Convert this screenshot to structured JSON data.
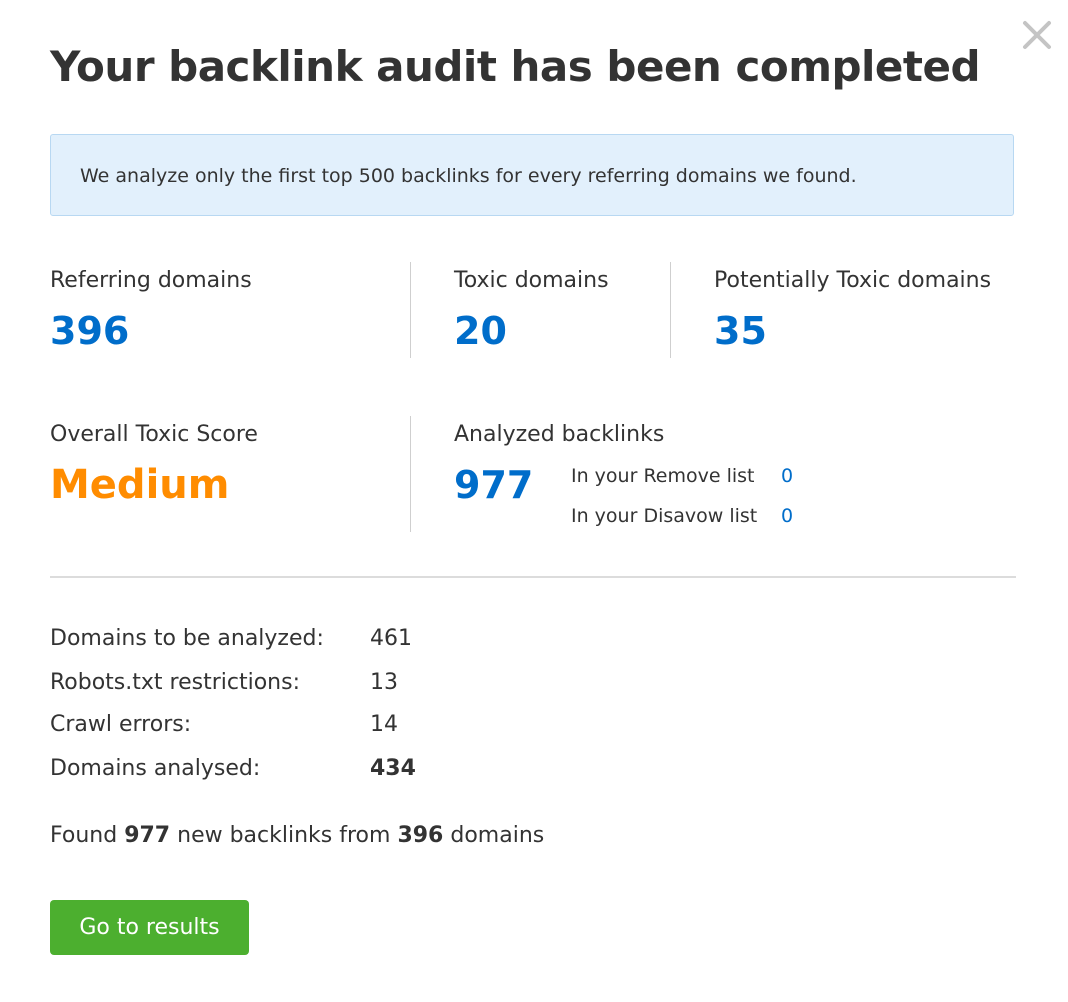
{
  "dialog": {
    "title": "Your backlink audit has been completed",
    "close_icon": "close-icon"
  },
  "info_banner": {
    "text": "We analyze only the first top 500 backlinks for every referring domains we found."
  },
  "stats": {
    "referring_domains": {
      "label": "Referring domains",
      "value": "396"
    },
    "toxic_domains": {
      "label": "Toxic domains",
      "value": "20"
    },
    "potentially_toxic_domains": {
      "label": "Potentially Toxic domains",
      "value": "35"
    },
    "overall_toxic_score": {
      "label": "Overall Toxic Score",
      "value": "Medium"
    },
    "analyzed_backlinks": {
      "label": "Analyzed backlinks",
      "value": "977",
      "remove_list": {
        "label": "In your Remove list",
        "value": "0"
      },
      "disavow_list": {
        "label": "In your Disavow list",
        "value": "0"
      }
    }
  },
  "details": [
    {
      "label": "Domains to be analyzed:",
      "value": "461"
    },
    {
      "label": "Robots.txt restrictions:",
      "value": "13"
    },
    {
      "label": "Crawl errors:",
      "value": "14"
    },
    {
      "label": "Domains analysed:",
      "value": "434"
    }
  ],
  "summary": {
    "prefix": "Found",
    "backlinks": "977",
    "middle": "new backlinks from",
    "domains": "396",
    "suffix": "domains"
  },
  "actions": {
    "go_to_results": "Go to results"
  },
  "colors": {
    "accent_blue": "#006dca",
    "score_orange": "#ff8c00",
    "button_green": "#4caf2f",
    "banner_bg": "#e2f0fc"
  }
}
